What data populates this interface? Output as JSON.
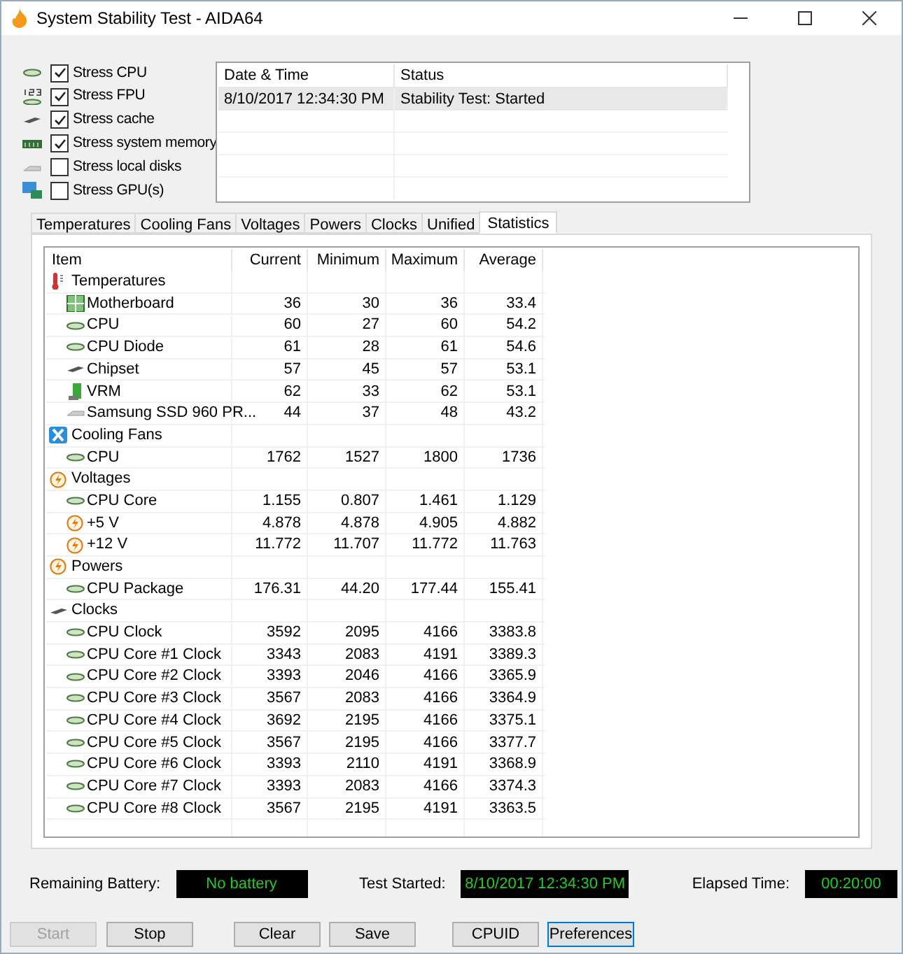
{
  "window": {
    "title": "System Stability Test - AIDA64"
  },
  "stress_options": [
    {
      "label": "Stress CPU",
      "checked": true
    },
    {
      "label": "Stress FPU",
      "checked": true
    },
    {
      "label": "Stress cache",
      "checked": true
    },
    {
      "label": "Stress system memory",
      "checked": true
    },
    {
      "label": "Stress local disks",
      "checked": false
    },
    {
      "label": "Stress GPU(s)",
      "checked": false
    }
  ],
  "log": {
    "columns": [
      "Date & Time",
      "Status"
    ],
    "rows": [
      {
        "date_time": "8/10/2017 12:34:30 PM",
        "status": "Stability Test: Started",
        "selected": true
      }
    ]
  },
  "tabs": [
    {
      "label": "Temperatures",
      "selected": false
    },
    {
      "label": "Cooling Fans",
      "selected": false
    },
    {
      "label": "Voltages",
      "selected": false
    },
    {
      "label": "Powers",
      "selected": false
    },
    {
      "label": "Clocks",
      "selected": false
    },
    {
      "label": "Unified",
      "selected": false
    },
    {
      "label": "Statistics",
      "selected": true
    }
  ],
  "statistics": {
    "columns": [
      "Item",
      "Current",
      "Minimum",
      "Maximum",
      "Average"
    ],
    "groups": [
      {
        "label": "Temperatures",
        "children": [
          {
            "item": "Motherboard",
            "current": "36",
            "minimum": "30",
            "maximum": "36",
            "average": "33.4"
          },
          {
            "item": "CPU",
            "current": "60",
            "minimum": "27",
            "maximum": "60",
            "average": "54.2"
          },
          {
            "item": "CPU Diode",
            "current": "61",
            "minimum": "28",
            "maximum": "61",
            "average": "54.6"
          },
          {
            "item": "Chipset",
            "current": "57",
            "minimum": "45",
            "maximum": "57",
            "average": "53.1"
          },
          {
            "item": "VRM",
            "current": "62",
            "minimum": "33",
            "maximum": "62",
            "average": "53.1"
          },
          {
            "item": "Samsung SSD 960 PR...",
            "current": "44",
            "minimum": "37",
            "maximum": "48",
            "average": "43.2"
          }
        ]
      },
      {
        "label": "Cooling Fans",
        "children": [
          {
            "item": "CPU",
            "current": "1762",
            "minimum": "1527",
            "maximum": "1800",
            "average": "1736"
          }
        ]
      },
      {
        "label": "Voltages",
        "children": [
          {
            "item": "CPU Core",
            "current": "1.155",
            "minimum": "0.807",
            "maximum": "1.461",
            "average": "1.129"
          },
          {
            "item": "+5 V",
            "current": "4.878",
            "minimum": "4.878",
            "maximum": "4.905",
            "average": "4.882"
          },
          {
            "item": "+12 V",
            "current": "11.772",
            "minimum": "11.707",
            "maximum": "11.772",
            "average": "11.763"
          }
        ]
      },
      {
        "label": "Powers",
        "children": [
          {
            "item": "CPU Package",
            "current": "176.31",
            "minimum": "44.20",
            "maximum": "177.44",
            "average": "155.41"
          }
        ]
      },
      {
        "label": "Clocks",
        "children": [
          {
            "item": "CPU Clock",
            "current": "3592",
            "minimum": "2095",
            "maximum": "4166",
            "average": "3383.8"
          },
          {
            "item": "CPU Core #1 Clock",
            "current": "3343",
            "minimum": "2083",
            "maximum": "4191",
            "average": "3389.3"
          },
          {
            "item": "CPU Core #2 Clock",
            "current": "3393",
            "minimum": "2046",
            "maximum": "4166",
            "average": "3365.9"
          },
          {
            "item": "CPU Core #3 Clock",
            "current": "3567",
            "minimum": "2083",
            "maximum": "4166",
            "average": "3364.9"
          },
          {
            "item": "CPU Core #4 Clock",
            "current": "3692",
            "minimum": "2195",
            "maximum": "4166",
            "average": "3375.1"
          },
          {
            "item": "CPU Core #5 Clock",
            "current": "3567",
            "minimum": "2195",
            "maximum": "4166",
            "average": "3377.7"
          },
          {
            "item": "CPU Core #6 Clock",
            "current": "3393",
            "minimum": "2110",
            "maximum": "4191",
            "average": "3368.9"
          },
          {
            "item": "CPU Core #7 Clock",
            "current": "3393",
            "minimum": "2083",
            "maximum": "4166",
            "average": "3374.3"
          },
          {
            "item": "CPU Core #8 Clock",
            "current": "3567",
            "minimum": "2195",
            "maximum": "4191",
            "average": "3363.5"
          }
        ]
      }
    ]
  },
  "status": [
    {
      "label": "Remaining Battery:",
      "value": "No battery"
    },
    {
      "label": "Test Started:",
      "value": "8/10/2017 12:34:30 PM"
    },
    {
      "label": "Elapsed Time:",
      "value": "00:20:00"
    }
  ],
  "buttons": [
    {
      "label": "Start",
      "disabled": true,
      "focused": false
    },
    {
      "label": "Stop",
      "disabled": false,
      "focused": false
    },
    {
      "label": "Clear",
      "disabled": false,
      "focused": false
    },
    {
      "label": "Save",
      "disabled": false,
      "focused": false
    },
    {
      "label": "CPUID",
      "disabled": false,
      "focused": false
    },
    {
      "label": "Preferences",
      "disabled": false,
      "focused": true
    }
  ]
}
